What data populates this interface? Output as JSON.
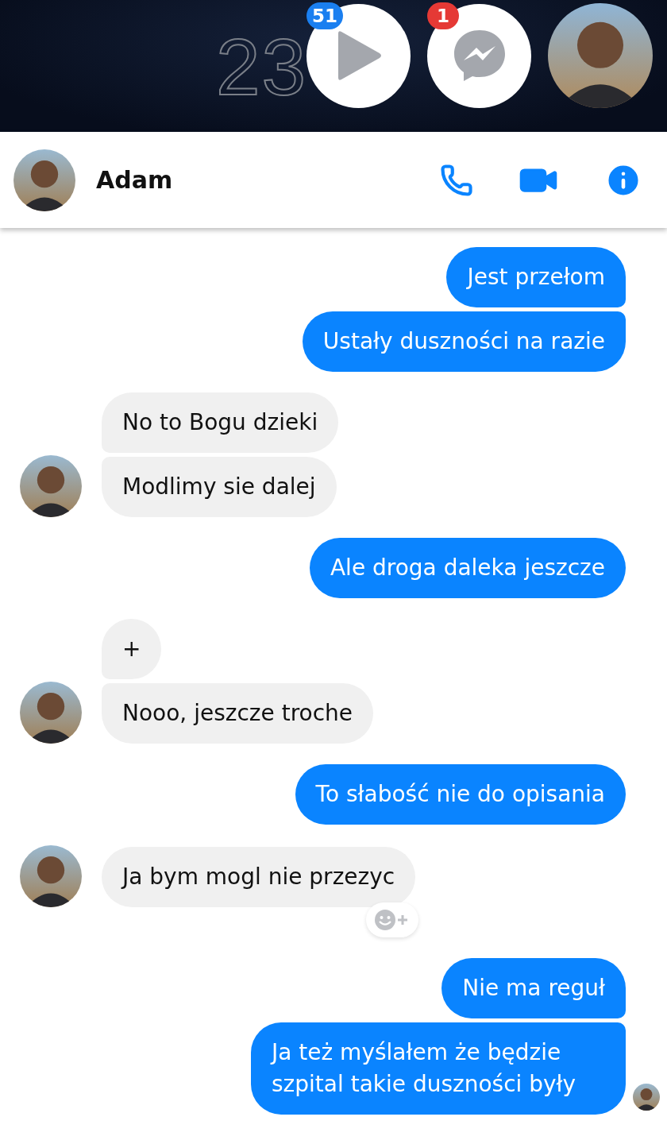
{
  "status": {
    "clock": "23"
  },
  "chat_heads": [
    {
      "kind": "video",
      "badge": "51",
      "color": "#1a7ff0"
    },
    {
      "kind": "messenger",
      "badge": "1",
      "color": "#e53935"
    },
    {
      "kind": "avatar"
    }
  ],
  "header": {
    "name": "Adam"
  },
  "groups": [
    {
      "kind": "outgoing",
      "messages": [
        "Jest przełom",
        "Ustały duszności na razie"
      ]
    },
    {
      "kind": "incoming",
      "messages": [
        "No to Bogu dzieki",
        "Modlimy sie dalej"
      ]
    },
    {
      "kind": "outgoing",
      "messages": [
        "Ale droga daleka jeszcze"
      ]
    },
    {
      "kind": "incoming",
      "messages": [
        "+",
        "Nooo, jeszcze troche"
      ]
    },
    {
      "kind": "outgoing",
      "messages": [
        "To słabość nie do opisania"
      ]
    },
    {
      "kind": "incoming",
      "messages": [
        "Ja bym mogl nie przezyc"
      ],
      "reaction_button": true
    },
    {
      "kind": "outgoing",
      "messages": [
        "Nie ma reguł",
        "Ja też myślałem że będzie szpital takie duszności były"
      ],
      "seen": true
    }
  ]
}
